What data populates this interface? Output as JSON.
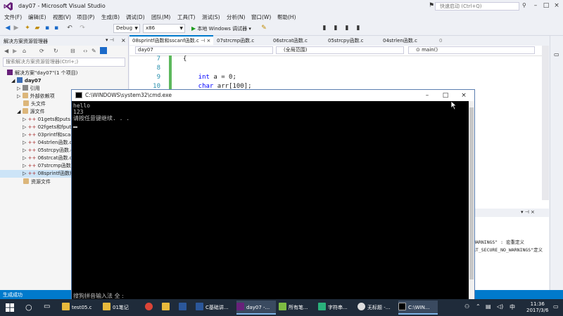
{
  "vs": {
    "title": "day07 - Microsoft Visual Studio",
    "quick_launch_placeholder": "快速启动 (Ctrl+Q)",
    "menu": [
      "文件(F)",
      "编辑(E)",
      "视图(V)",
      "项目(P)",
      "生成(B)",
      "调试(D)",
      "团队(M)",
      "工具(T)",
      "测试(S)",
      "分析(N)",
      "窗口(W)",
      "帮助(H)"
    ],
    "config": "Debug",
    "platform": "x86",
    "run_label": "本地 Windows 调试器"
  },
  "solution_explorer": {
    "title": "解决方案资源管理器",
    "search_placeholder": "搜索解决方案资源管理器(Ctrl+;)",
    "solution": "解决方案\"day07\"(1 个项目)",
    "project": "day07",
    "nodes": [
      "引用",
      "外部依赖项",
      "头文件",
      "源文件"
    ],
    "files": [
      "01gets和puts",
      "02fgets和fput",
      "03printf和scan",
      "04strlen函数.c",
      "05strcpy函数.c",
      "06strcat函数.c",
      "07strcmp函数",
      "08sprintf函数和"
    ],
    "resource_folder": "资源文件"
  },
  "editor": {
    "tabs": [
      "08sprintf函数和sscanf函数.c",
      "07strcmp函数.c",
      "06strcat函数.c",
      "05strcpy函数.c",
      "04strlen函数.c"
    ],
    "nav_project": "day07",
    "nav_scope": "(全局范围)",
    "nav_function": "main()",
    "lines": [
      {
        "no": "7",
        "code": "{"
      },
      {
        "no": "8",
        "code": ""
      },
      {
        "no": "9",
        "code": "    int a = 0;"
      },
      {
        "no": "10",
        "code": "    char arr[100];"
      }
    ],
    "output_lines": [
      "WARNINGS\" : 宏重定义",
      "RT_SECURE_NO_WARNINGS\"定义"
    ]
  },
  "status": "生成成功",
  "cmd": {
    "title": "C:\\WINDOWS\\system32\\cmd.exe",
    "lines": [
      "hello",
      "123",
      "请按任意键继续. . ."
    ],
    "ime": "搜狗拼音输入法 全 :"
  },
  "taskbar": {
    "items": [
      "test05.c",
      "01笔记",
      "",
      "",
      "",
      "C基础讲...",
      "day07 -...",
      "所有笔...",
      "字符串...",
      "无标题 -...",
      "C:\\WIN..."
    ],
    "time": "11:36",
    "date": "2017/3/6"
  }
}
